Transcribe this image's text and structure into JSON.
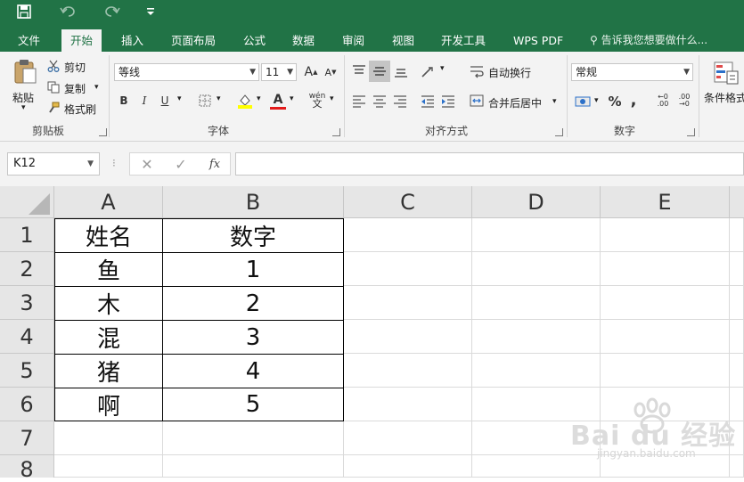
{
  "tabs": [
    "文件",
    "开始",
    "插入",
    "页面布局",
    "公式",
    "数据",
    "审阅",
    "视图",
    "开发工具",
    "WPS PDF"
  ],
  "active_tab": "开始",
  "tell_me": "告诉我您想要做什么...",
  "clipboard": {
    "paste": "粘贴",
    "cut": "剪切",
    "copy": "复制",
    "format_painter": "格式刷",
    "group": "剪贴板"
  },
  "font": {
    "name": "等线",
    "size": "11",
    "bold": "B",
    "italic": "I",
    "underline": "U",
    "grow": "A",
    "shrink": "A",
    "phonetic": "wén",
    "group": "字体"
  },
  "alignment": {
    "wrap": "自动换行",
    "merge": "合并后居中",
    "group": "对齐方式"
  },
  "number": {
    "format": "常规",
    "percent": "%",
    "comma": ",",
    "group": "数字"
  },
  "styles": {
    "conditional": "条件格式"
  },
  "formula_bar": {
    "name_box": "K12",
    "fx": "fx",
    "formula": ""
  },
  "columns": [
    "A",
    "B",
    "C",
    "D",
    "E"
  ],
  "rows": [
    "1",
    "2",
    "3",
    "4",
    "5",
    "6",
    "7",
    "8"
  ],
  "cells": [
    [
      "姓名",
      "数字"
    ],
    [
      "鱼",
      "1"
    ],
    [
      "木",
      "2"
    ],
    [
      "混",
      "3"
    ],
    [
      "猪",
      "4"
    ],
    [
      "啊",
      "5"
    ]
  ],
  "watermark": {
    "brand": "Bai du 经验",
    "url": "jingyan.baidu.com"
  }
}
